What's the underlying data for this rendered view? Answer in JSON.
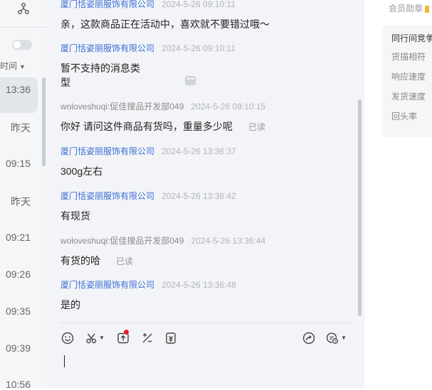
{
  "conversation_list": {
    "sort_label": "时间",
    "times": [
      "13:36",
      "昨天",
      "09:15",
      "昨天",
      "09:21",
      "09:26",
      "09:35",
      "09:39",
      "10:56"
    ]
  },
  "chat": {
    "messages": [
      {
        "sender": "厦门恬姿丽服饰有限公司",
        "time": "2024-5-26 09:10:11",
        "role": "seller",
        "text": "亲，这款商品正在活动中，喜欢就不要错过哦～"
      },
      {
        "sender": "厦门恬姿丽服饰有限公司",
        "time": "2024-5-26 09:10:11",
        "role": "seller",
        "text_line1": "暂不支持的消息类",
        "text_line2": "型"
      },
      {
        "sender": "woloveshuqi:促佳搜品开发部049",
        "time": "2024-5-26 09:10:15",
        "role": "buyer",
        "text": "你好 请问这件商品有货吗，重量多少呢",
        "read": "已读"
      },
      {
        "sender": "厦门恬姿丽服饰有限公司",
        "time": "2024-5-26 13:36:37",
        "role": "seller",
        "text": "300g左右"
      },
      {
        "sender": "厦门恬姿丽服饰有限公司",
        "time": "2024-5-26 13:36:42",
        "role": "seller",
        "text": "有现货"
      },
      {
        "sender": "woloveshuqi:促佳搜品开发部049",
        "time": "2024-5-26 13:36:44",
        "role": "buyer",
        "text": "有货的哈",
        "read": "已读"
      },
      {
        "sender": "厦门恬姿丽服饰有限公司",
        "time": "2024-5-26 13:36:48",
        "role": "seller",
        "text": "是的"
      }
    ],
    "more_icon": "ellipsis-icon"
  },
  "toolbar": {
    "icons": [
      "emoji-icon",
      "scissors-icon",
      "upload-icon",
      "quick-reply-icon",
      "coupon-icon",
      "share-icon",
      "history-icon"
    ]
  },
  "right_panel": {
    "member_label": "会员勋章",
    "card_title": "同行间竞争",
    "metrics": [
      "货描相符",
      "响应速度",
      "发货速度",
      "回头率"
    ]
  }
}
